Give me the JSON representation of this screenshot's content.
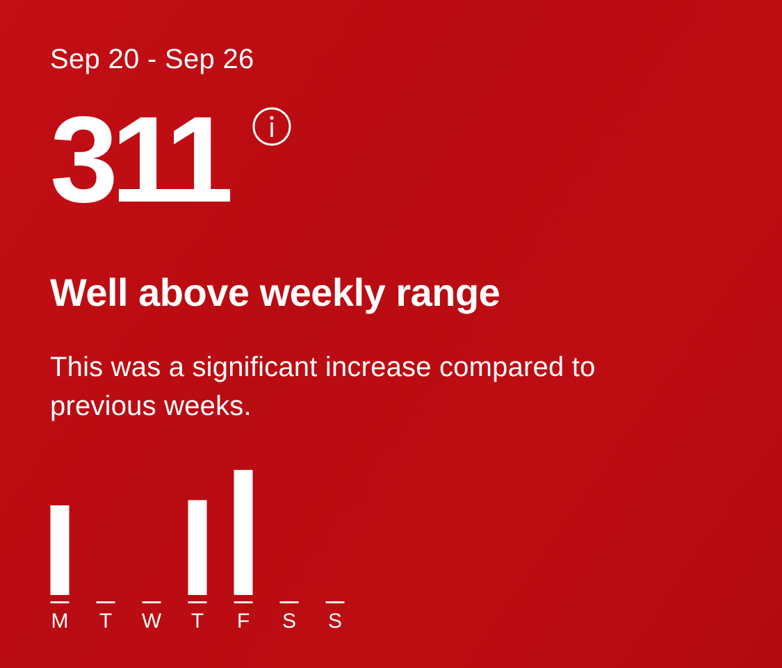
{
  "summary": {
    "date_range": "Sep 20 - Sep 26",
    "value": "311",
    "info_icon": "info-circle-icon",
    "status_title": "Well above weekly range",
    "status_description": "This was a significant increase compared to previous weeks."
  },
  "colors": {
    "background": "#bd0d13",
    "foreground": "#ffffff"
  },
  "chart_data": {
    "type": "bar",
    "categories": [
      "M",
      "T",
      "W",
      "T",
      "F",
      "S",
      "S"
    ],
    "values": [
      86,
      0,
      0,
      91,
      120,
      0,
      0
    ],
    "ylim": [
      0,
      120
    ],
    "grid": false,
    "title": "",
    "xlabel": "",
    "ylabel": ""
  }
}
